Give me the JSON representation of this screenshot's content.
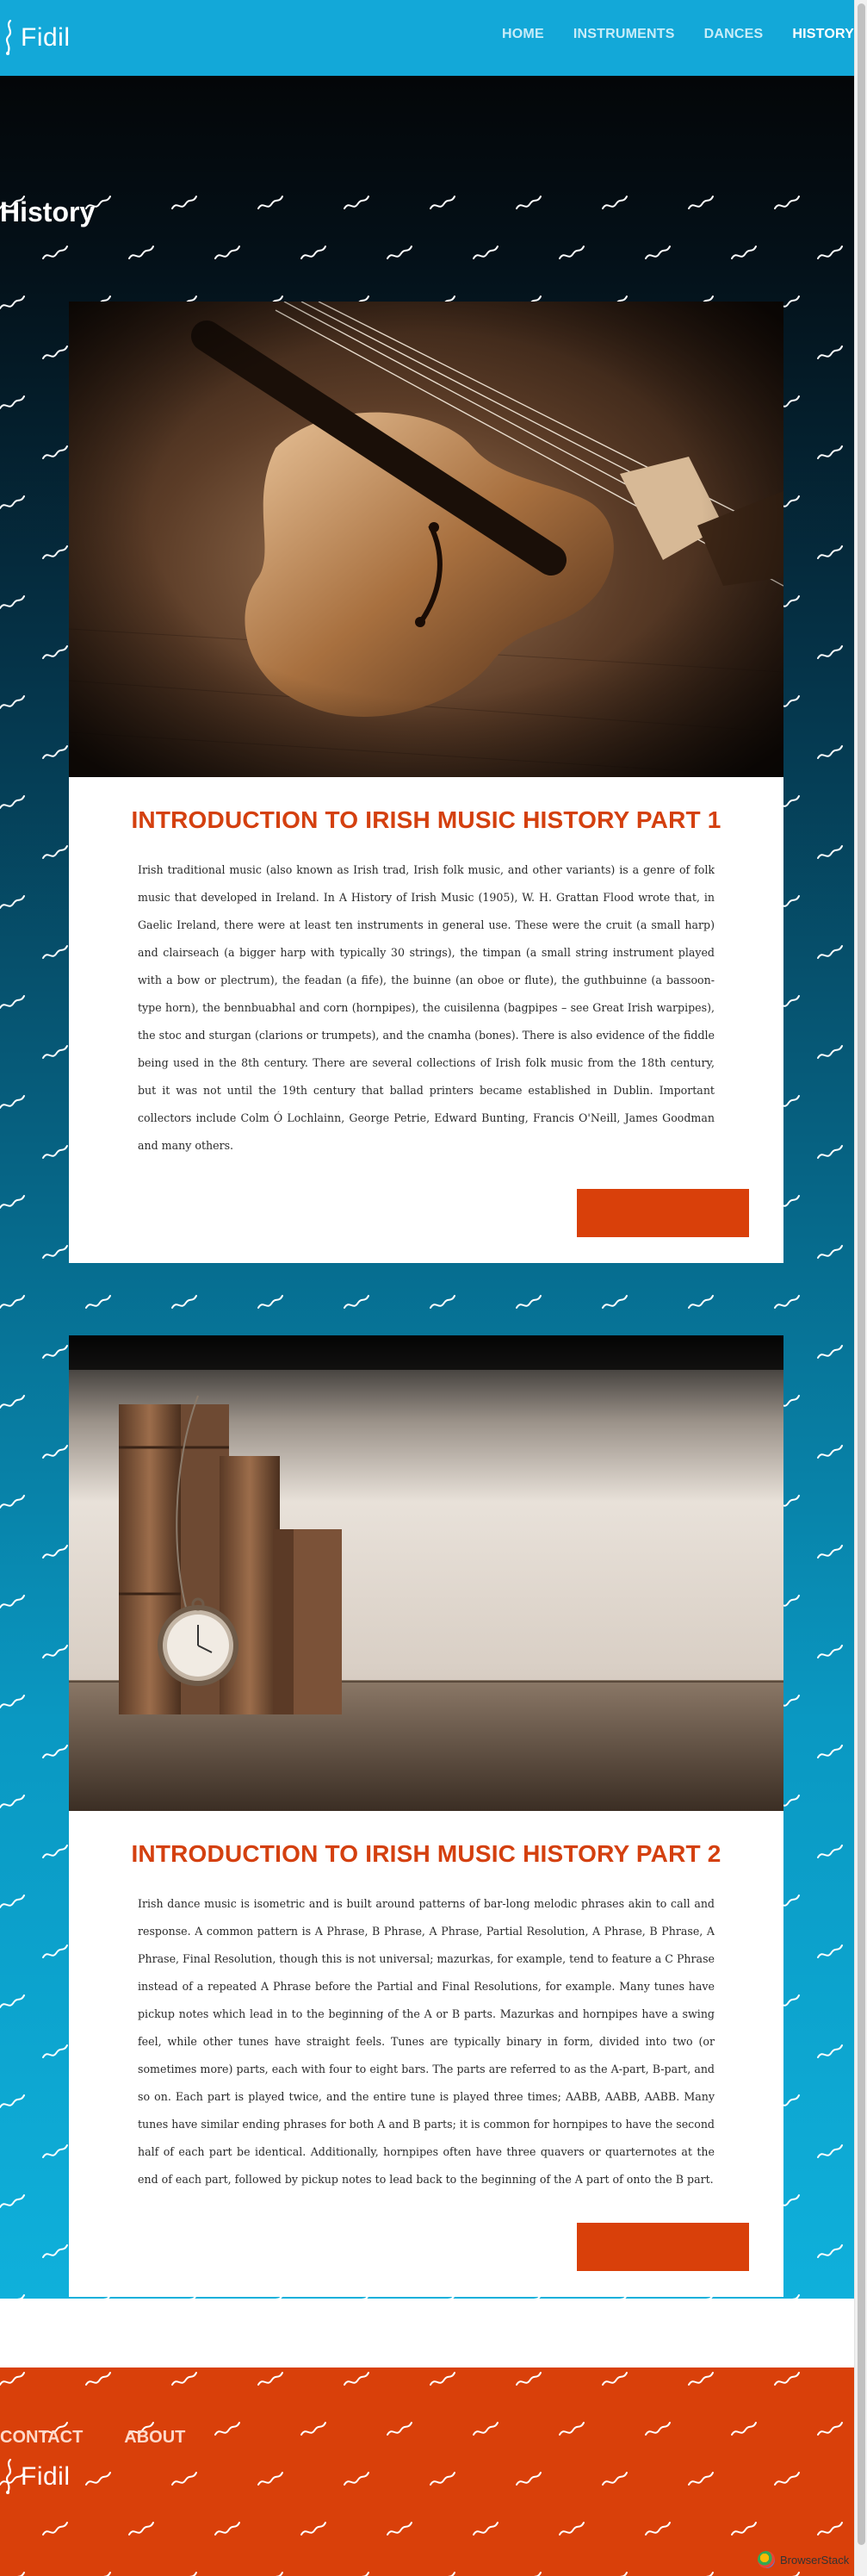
{
  "header": {
    "logo_text": "Fidil",
    "nav": [
      {
        "label": "HOME",
        "active": false
      },
      {
        "label": "INSTRUMENTS",
        "active": false
      },
      {
        "label": "DANCES",
        "active": false
      },
      {
        "label": "HISTORY",
        "active": true
      }
    ]
  },
  "page": {
    "title": "History"
  },
  "articles": [
    {
      "title": "INTRODUCTION TO IRISH MUSIC HISTORY PART 1",
      "image": "violin-photo",
      "text": "Irish traditional music (also known as Irish trad, Irish folk music, and other variants) is a genre of folk music that developed in Ireland. In A History of Irish Music (1905), W. H. Grattan Flood wrote that, in Gaelic Ireland, there were at least ten instruments in general use. These were the cruit (a small harp) and clairseach (a bigger harp with typically 30 strings), the timpan (a small string instrument played with a bow or plectrum), the feadan (a fife), the buinne (an oboe or flute), the guthbuinne (a bassoon-type horn), the bennbuabhal and corn (hornpipes), the cuisilenna (bagpipes – see Great Irish warpipes), the stoc and sturgan (clarions or trumpets), and the cnamha (bones). There is also evidence of the fiddle being used in the 8th century. There are several collections of Irish folk music from the 18th century, but it was not until the 19th century that ballad printers became established in Dublin. Important collectors include Colm Ó Lochlainn, George Petrie, Edward Bunting, Francis O'Neill, James Goodman and many others."
    },
    {
      "title": "INTRODUCTION TO IRISH MUSIC HISTORY PART 2",
      "image": "books-and-pocket-watch-photo",
      "text": "Irish dance music is isometric and is built around patterns of bar-long melodic phrases akin to call and response. A common pattern is A Phrase, B Phrase, A Phrase, Partial Resolution, A Phrase, B Phrase, A Phrase, Final Resolution, though this is not universal; mazurkas, for example, tend to feature a C Phrase instead of a repeated A Phrase before the Partial and Final Resolutions, for example. Many tunes have pickup notes which lead in to the beginning of the A or B parts. Mazurkas and hornpipes have a swing feel, while other tunes have straight feels. Tunes are typically binary in form, divided into two (or sometimes more) parts, each with four to eight bars. The parts are referred to as the A-part, B-part, and so on. Each part is played twice, and the entire tune is played three times; AABB, AABB, AABB. Many tunes have similar ending phrases for both A and B parts; it is common for hornpipes to have the second half of each part be identical. Additionally, hornpipes often have three quavers or quarternotes at the end of each part, followed by pickup notes to lead back to the beginning of the A part of onto the B part."
    }
  ],
  "footer": {
    "links": [
      "CONTACT",
      "ABOUT"
    ],
    "logo_text": "Fidil"
  },
  "badge": {
    "text": "BrowserStack"
  },
  "colors": {
    "header_bg": "#13a8d8",
    "accent": "#d9400a",
    "title": "#d4400f"
  }
}
